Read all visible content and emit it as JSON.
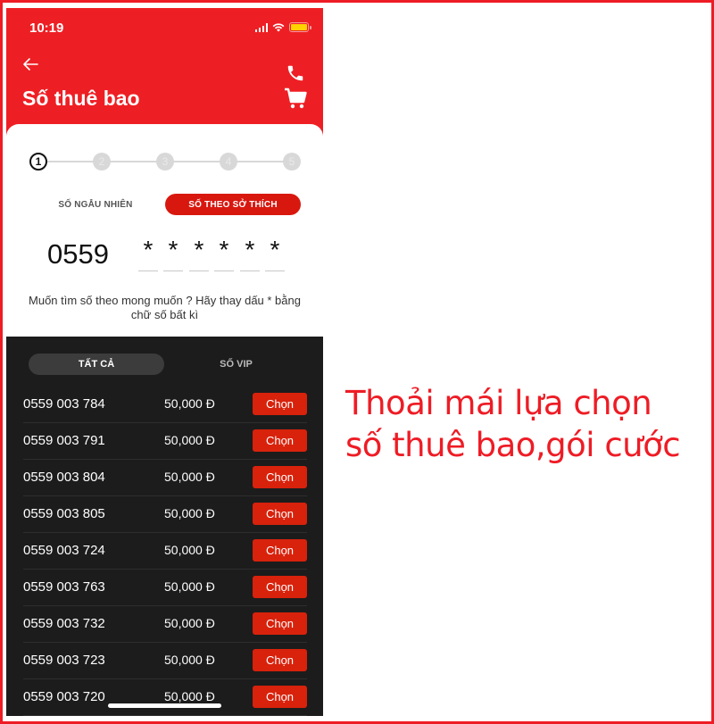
{
  "status_bar": {
    "time": "10:19",
    "icons": [
      "signal-icon",
      "wifi-icon",
      "battery-icon"
    ]
  },
  "header": {
    "title": "Số thuê bao",
    "back_icon": "arrow-left-icon",
    "actions": [
      "phone-icon",
      "cart-icon"
    ]
  },
  "stepper": {
    "current_step": 1,
    "steps": [
      "1",
      "2",
      "3",
      "4",
      "5"
    ]
  },
  "mode_tabs": {
    "random": "SỐ NGẪU NHIÊN",
    "preference": "SỐ THEO SỞ THÍCH",
    "active": "preference"
  },
  "number_input": {
    "prefix": "0559",
    "digits": [
      "*",
      "*",
      "*",
      "*",
      "*",
      "*"
    ]
  },
  "hint": "Muốn tìm số theo mong muốn ? Hãy thay dấu * bằng chữ số bất kì",
  "list_tabs": {
    "all": "TẤT CẢ",
    "vip": "SỐ VIP",
    "active": "all"
  },
  "numbers": [
    {
      "number": "0559 003 784",
      "price": "50,000 Đ",
      "action": "Chọn"
    },
    {
      "number": "0559 003 791",
      "price": "50,000 Đ",
      "action": "Chọn"
    },
    {
      "number": "0559 003 804",
      "price": "50,000 Đ",
      "action": "Chọn"
    },
    {
      "number": "0559 003 805",
      "price": "50,000 Đ",
      "action": "Chọn"
    },
    {
      "number": "0559 003 724",
      "price": "50,000 Đ",
      "action": "Chọn"
    },
    {
      "number": "0559 003 763",
      "price": "50,000 Đ",
      "action": "Chọn"
    },
    {
      "number": "0559 003 732",
      "price": "50,000 Đ",
      "action": "Chọn"
    },
    {
      "number": "0559 003 723",
      "price": "50,000 Đ",
      "action": "Chọn"
    },
    {
      "number": "0559 003 720",
      "price": "50,000 Đ",
      "action": "Chọn"
    }
  ],
  "promo": {
    "line1": "Thoải mái lựa chọn",
    "line2": "số thuê bao,gói cước"
  },
  "colors": {
    "brand_red": "#ee1f24",
    "button_red": "#d8220c",
    "list_bg": "#1c1c1c",
    "battery_fill": "#ffd200"
  }
}
